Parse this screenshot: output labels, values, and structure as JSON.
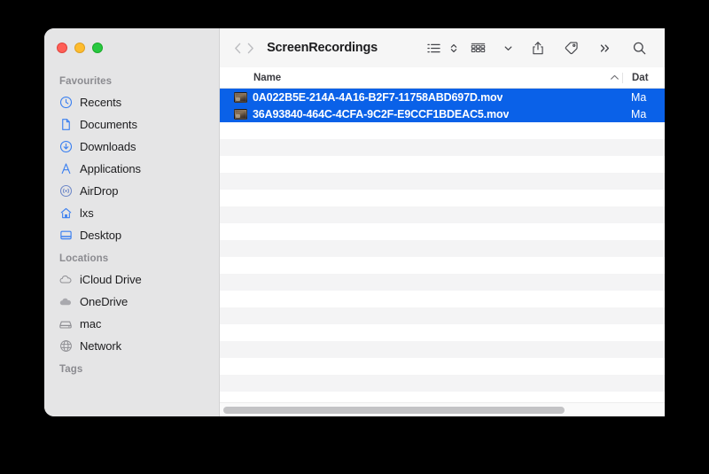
{
  "window": {
    "title": "ScreenRecordings",
    "traffic_lights": [
      {
        "name": "close",
        "color": "#ff5f57"
      },
      {
        "name": "minimize",
        "color": "#febc2e"
      },
      {
        "name": "zoom",
        "color": "#28c840"
      }
    ]
  },
  "toolbar": {
    "back_label": "Back",
    "forward_label": "Forward",
    "view_list_label": "List view",
    "view_options_label": "View options",
    "group_label": "Group",
    "group_chevron_label": "Group options",
    "share_label": "Share",
    "tag_label": "Tags",
    "more_label": "More toolbar items",
    "search_label": "Search"
  },
  "sidebar": {
    "sections": [
      {
        "title": "Favourites",
        "items": [
          {
            "label": "Recents",
            "icon": "clock-icon"
          },
          {
            "label": "Documents",
            "icon": "document-icon"
          },
          {
            "label": "Downloads",
            "icon": "download-icon"
          },
          {
            "label": "Applications",
            "icon": "applications-icon"
          },
          {
            "label": "AirDrop",
            "icon": "airdrop-icon"
          },
          {
            "label": "lxs",
            "icon": "home-icon"
          },
          {
            "label": "Desktop",
            "icon": "desktop-icon"
          }
        ]
      },
      {
        "title": "Locations",
        "items": [
          {
            "label": "iCloud Drive",
            "icon": "cloud-icon"
          },
          {
            "label": "OneDrive",
            "icon": "cloud-filled-icon"
          },
          {
            "label": "mac",
            "icon": "harddisk-icon"
          },
          {
            "label": "Network",
            "icon": "globe-icon"
          }
        ]
      },
      {
        "title": "Tags",
        "items": []
      }
    ]
  },
  "file_list": {
    "columns": {
      "name": "Name",
      "date": "Dat",
      "sort_indicator": "ascending"
    },
    "rows": [
      {
        "name": "0A022B5E-214A-4A16-B2F7-11758ABD697D.mov",
        "date": "Ma",
        "selected": true,
        "icon": "movie-thumbnail"
      },
      {
        "name": "36A93840-464C-4CFA-9C2F-E9CCF1BDEAC5.mov",
        "date": "Ma",
        "selected": true,
        "icon": "movie-thumbnail"
      }
    ],
    "empty_row_count": 16
  },
  "colors": {
    "selection_blue": "#0a61e8",
    "sidebar_bg": "#e5e5e6",
    "toolbar_bg": "#f6f6f6",
    "stripe_bg": "#f4f4f5",
    "desktop_bg": "#000000"
  }
}
